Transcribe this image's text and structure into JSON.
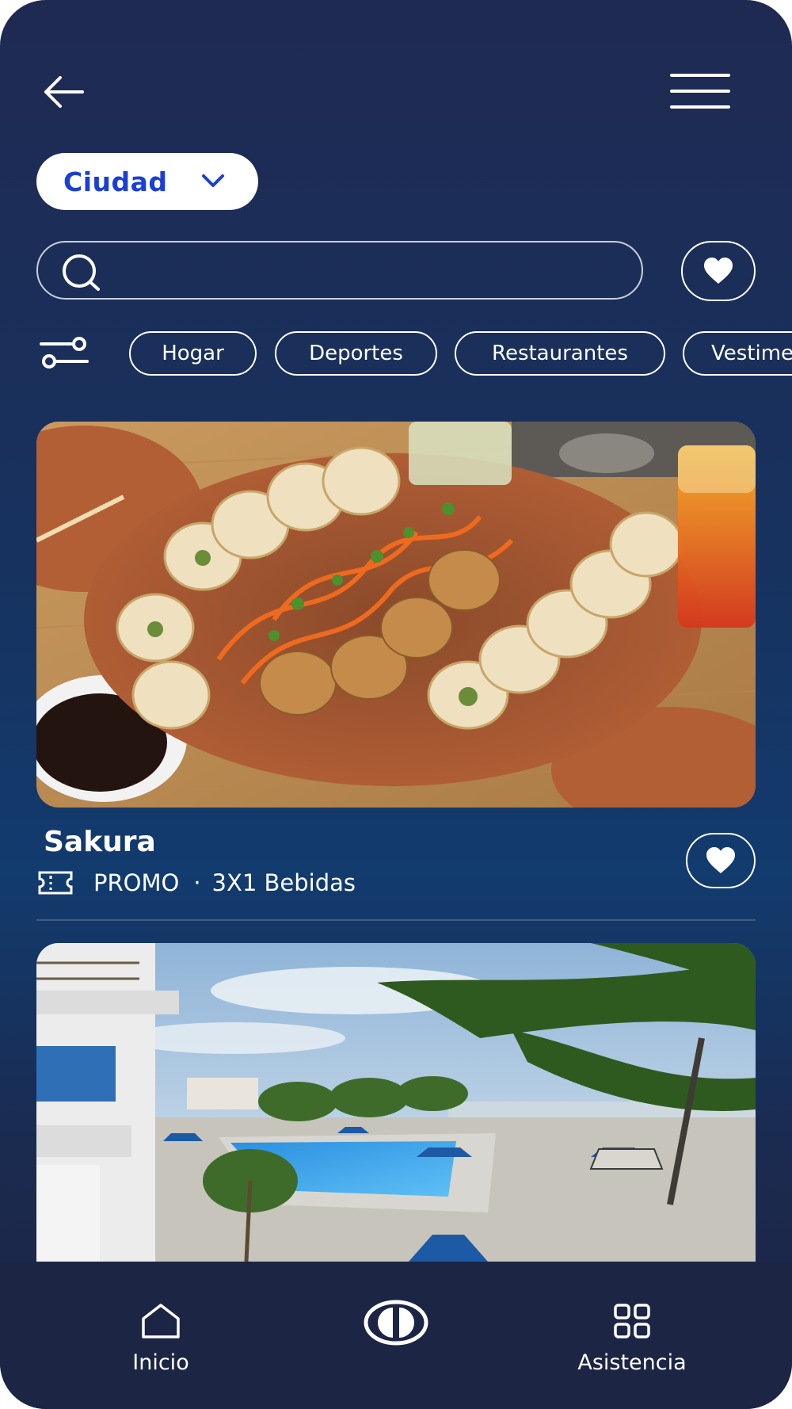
{
  "header": {
    "back_icon": "arrow-left-icon",
    "menu_icon": "hamburger-menu-icon"
  },
  "city_selector": {
    "label": "Ciudad",
    "icon": "chevron-down-icon"
  },
  "search": {
    "placeholder": "",
    "value": "",
    "icon": "search-icon"
  },
  "favorites_icon": "heart-icon",
  "filters": {
    "icon": "filter-sliders-icon",
    "chips": [
      {
        "label": "Hogar"
      },
      {
        "label": "Deportes"
      },
      {
        "label": "Restaurantes"
      },
      {
        "label": "Vestimenta"
      }
    ]
  },
  "cards": [
    {
      "title": "Sakura",
      "promo_icon": "ticket-icon",
      "promo_tag": "PROMO",
      "separator": "·",
      "promo_text": "3X1 Bebidas",
      "image": "sushi-platter-photo",
      "favorite_icon": "heart-icon"
    },
    {
      "image": "beach-hotel-pool-photo"
    }
  ],
  "bottom_nav": {
    "items": [
      {
        "label": "Inicio",
        "icon": "home-icon"
      },
      {
        "label": "",
        "icon": "brand-logo-icon"
      },
      {
        "label": "Asistencia",
        "icon": "grid-icon"
      }
    ]
  },
  "colors": {
    "background": "#1f2a52",
    "accent_blue": "#1a3fd6",
    "nav_background": "#1c2544",
    "text": "#ffffff"
  }
}
